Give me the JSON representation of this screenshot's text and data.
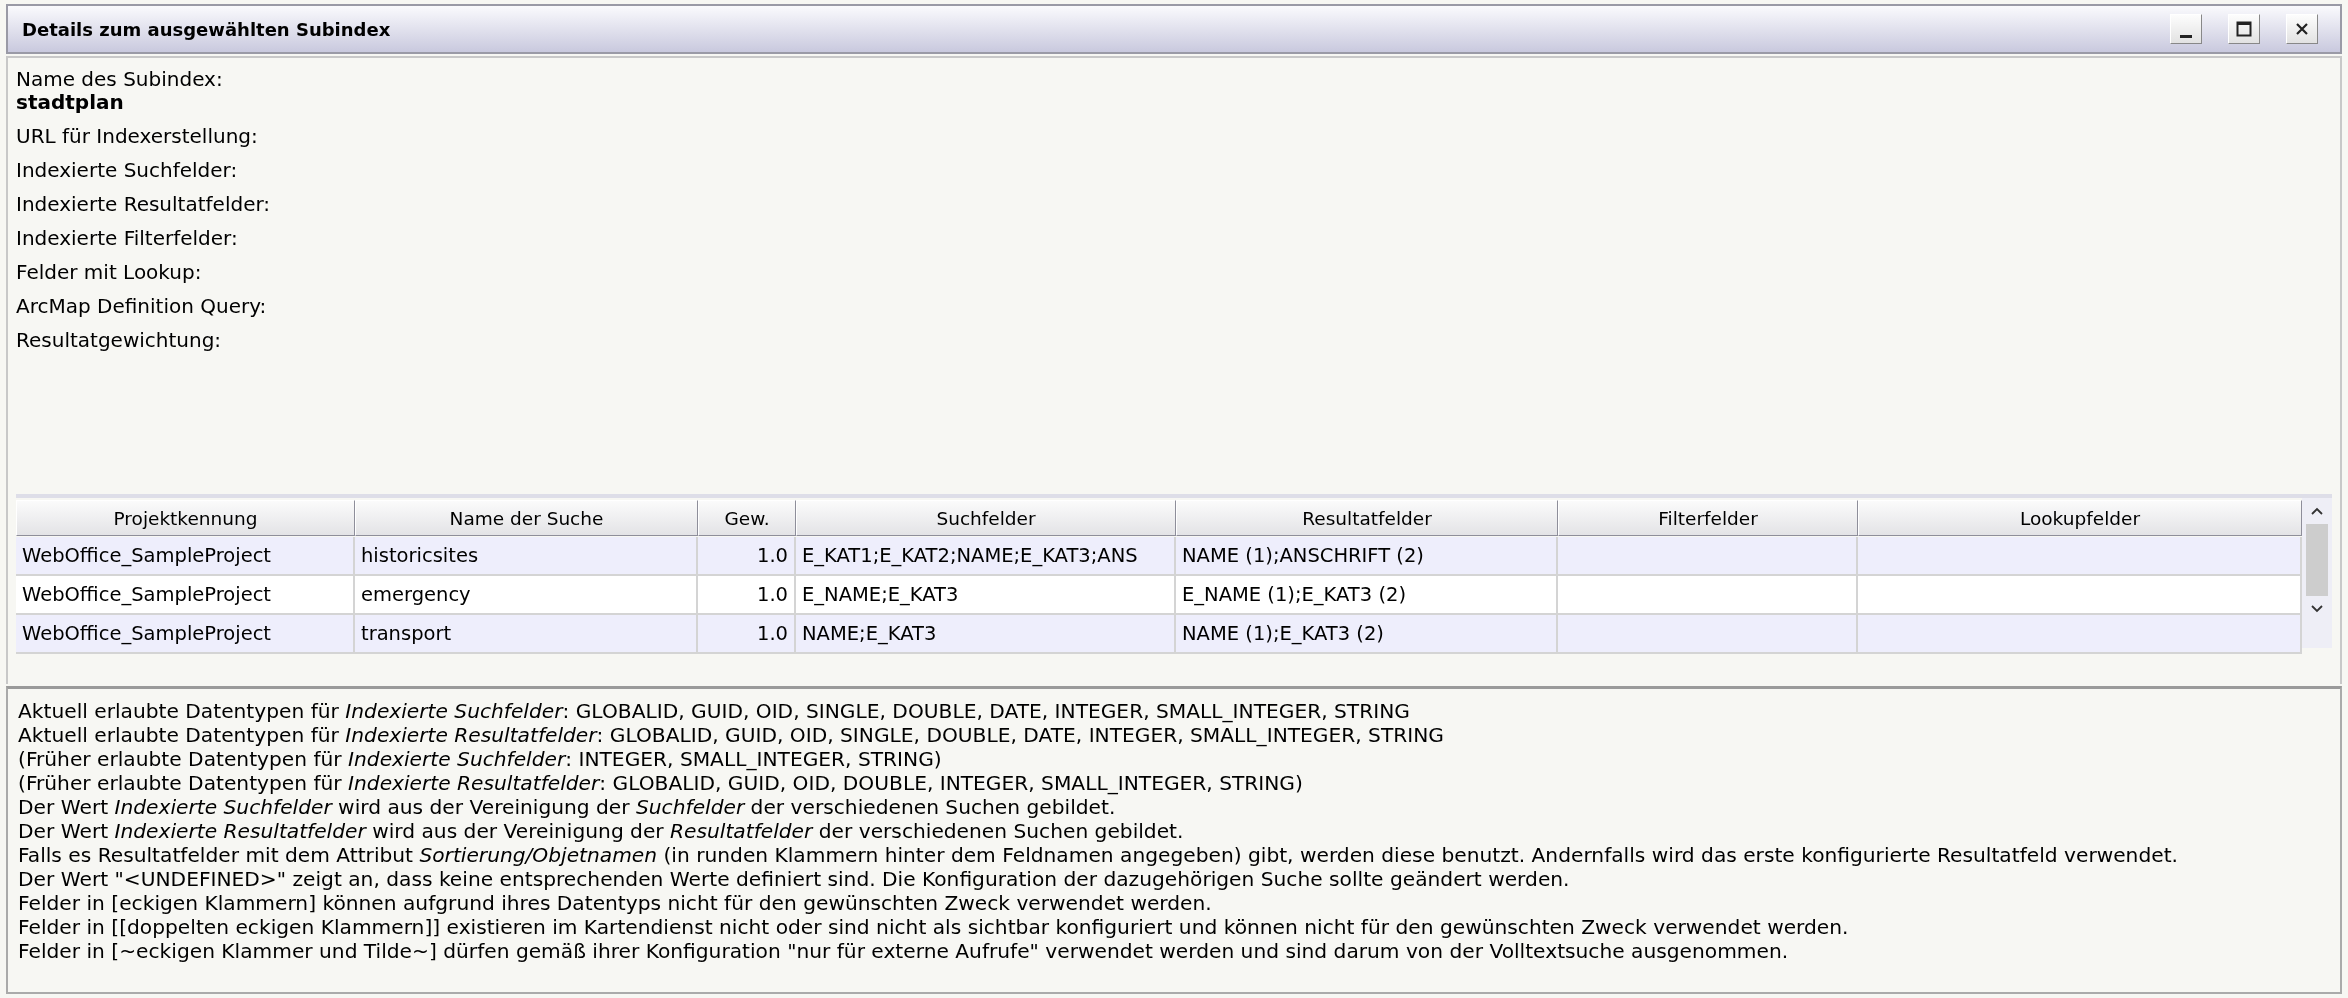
{
  "window": {
    "title": "Details zum ausgewählten Subindex"
  },
  "details": [
    {
      "label": "Name des Subindex:",
      "value": "stadtplan"
    },
    {
      "label": "URL für Indexerstellung:"
    },
    {
      "label": "Indexierte Suchfelder:"
    },
    {
      "label": "Indexierte Resultatfelder:"
    },
    {
      "label": "Indexierte Filterfelder:"
    },
    {
      "label": "Felder mit Lookup:"
    },
    {
      "label": "ArcMap Definition Query:"
    },
    {
      "label": "Resultatgewichtung:"
    }
  ],
  "table": {
    "columns": [
      "Projektkennung",
      "Name der Suche",
      "Gew.",
      "Suchfelder",
      "Resultatfelder",
      "Filterfelder",
      "Lookupfelder"
    ],
    "rows": [
      [
        "WebOffice_SampleProject",
        "historicsites",
        "1.0",
        "E_KAT1;E_KAT2;NAME;E_KAT3;ANS",
        "NAME (1);ANSCHRIFT (2)",
        "",
        ""
      ],
      [
        "WebOffice_SampleProject",
        "emergency",
        "1.0",
        "E_NAME;E_KAT3",
        "E_NAME (1);E_KAT3 (2)",
        "",
        ""
      ],
      [
        "WebOffice_SampleProject",
        "transport",
        "1.0",
        "NAME;E_KAT3",
        "NAME (1);E_KAT3 (2)",
        "",
        ""
      ]
    ]
  },
  "notes": [
    "Aktuell erlaubte Datentypen für *Indexierte Suchfelder*: GLOBALID, GUID, OID, SINGLE, DOUBLE, DATE, INTEGER, SMALL_INTEGER, STRING",
    "Aktuell erlaubte Datentypen für *Indexierte Resultatfelder*: GLOBALID, GUID, OID, SINGLE, DOUBLE, DATE, INTEGER, SMALL_INTEGER, STRING",
    "(Früher erlaubte Datentypen für *Indexierte Suchfelder*: INTEGER, SMALL_INTEGER, STRING)",
    "(Früher erlaubte Datentypen für *Indexierte Resultatfelder*: GLOBALID, GUID, OID, DOUBLE, INTEGER, SMALL_INTEGER, STRING)",
    "Der Wert *Indexierte Suchfelder* wird aus der Vereinigung der *Suchfelder* der verschiedenen Suchen gebildet.",
    "Der Wert *Indexierte Resultatfelder* wird aus der Vereinigung der *Resultatfelder* der verschiedenen Suchen gebildet.",
    "Falls es Resultatfelder mit dem Attribut *Sortierung/Objetnamen* (in runden Klammern hinter dem Feldnamen angegeben) gibt, werden diese benutzt. Andernfalls wird das erste konfigurierte Resultatfeld verwendet.",
    "Der Wert \"<UNDEFINED>\" zeigt an, dass keine entsprechenden Werte definiert sind. Die Konfiguration der dazugehörigen Suche sollte geändert werden.",
    "Felder in [eckigen Klammern] können aufgrund ihres Datentyps nicht für den gewünschten Zweck verwendet werden.",
    "Felder in [[doppelten eckigen Klammern]] existieren im Kartendienst nicht oder sind nicht als sichtbar konfiguriert und können nicht für den gewünschten Zweck verwendet werden.",
    "Felder in [~eckigen Klammer und Tilde~] dürfen gemäß ihrer Konfiguration \"nur für externe Aufrufe\" verwendet werden und sind darum von der Volltextsuche ausgenommen."
  ]
}
